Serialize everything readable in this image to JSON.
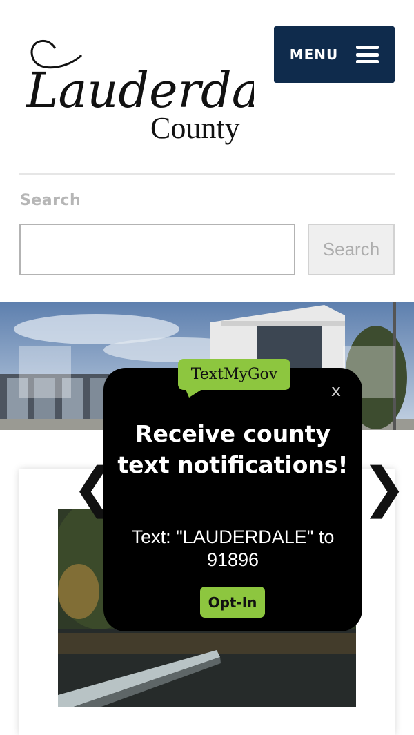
{
  "header": {
    "logo_script": "Lauderdale",
    "logo_county": "County",
    "menu_label": "MENU"
  },
  "search": {
    "label": "Search",
    "input_value": "",
    "button_label": "Search"
  },
  "popup": {
    "badge": "TextMyGov",
    "close_label": "x",
    "heading": "Receive county text notifications!",
    "text": "Text: \"LAUDERDALE\" to 91896",
    "optin_label": "Opt-In"
  },
  "carousel": {
    "prev_arrow": "❮",
    "next_arrow": "❯"
  },
  "colors": {
    "menu_bg": "#0f2b4c",
    "badge_green": "#8dc63f",
    "popup_bg": "#000000"
  }
}
